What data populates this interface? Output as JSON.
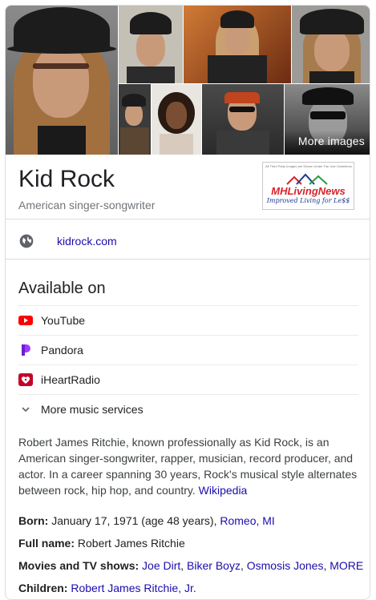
{
  "header": {
    "more_images_label": "More images",
    "title": "Kid Rock",
    "subtitle": "American singer-songwriter"
  },
  "logo": {
    "fine_print": "All Third Party Images are Shown Under Fair Use Guidelines",
    "name": "MHLivingNews",
    "tagline": "Improved Living for Le$$"
  },
  "website": {
    "icon": "globe-icon",
    "link": "kidrock.com"
  },
  "available_on": {
    "heading": "Available on",
    "services": [
      {
        "label": "YouTube",
        "icon": "youtube-icon",
        "color": "#ff0000"
      },
      {
        "label": "Pandora",
        "icon": "pandora-icon",
        "color": "#a03bff"
      },
      {
        "label": "iHeartRadio",
        "icon": "iheartradio-icon",
        "color": "#c6002b"
      }
    ],
    "more_label": "More music services"
  },
  "description": {
    "text": "Robert James Ritchie, known professionally as Kid Rock, is an American singer-songwriter, rapper, musician, record producer, and actor. In a career spanning 30 years, Rock's musical style alternates between rock, hip hop, and country. ",
    "source": "Wikipedia"
  },
  "facts": {
    "born_label": "Born:",
    "born_value": " January 17, 1971 (age 48 years), ",
    "born_place": "Romeo, MI",
    "fullname_label": "Full name:",
    "fullname_value": " Robert James Ritchie",
    "movies_label": "Movies and TV shows:",
    "movies": [
      "Joe Dirt",
      "Biker Boyz",
      "Osmosis Jones",
      "MORE"
    ],
    "children_label": "Children:",
    "children_value": "Robert James Ritchie, Jr."
  },
  "colors": {
    "link": "#1a0dab",
    "divider": "#dadce0",
    "text_secondary": "#70757a"
  }
}
